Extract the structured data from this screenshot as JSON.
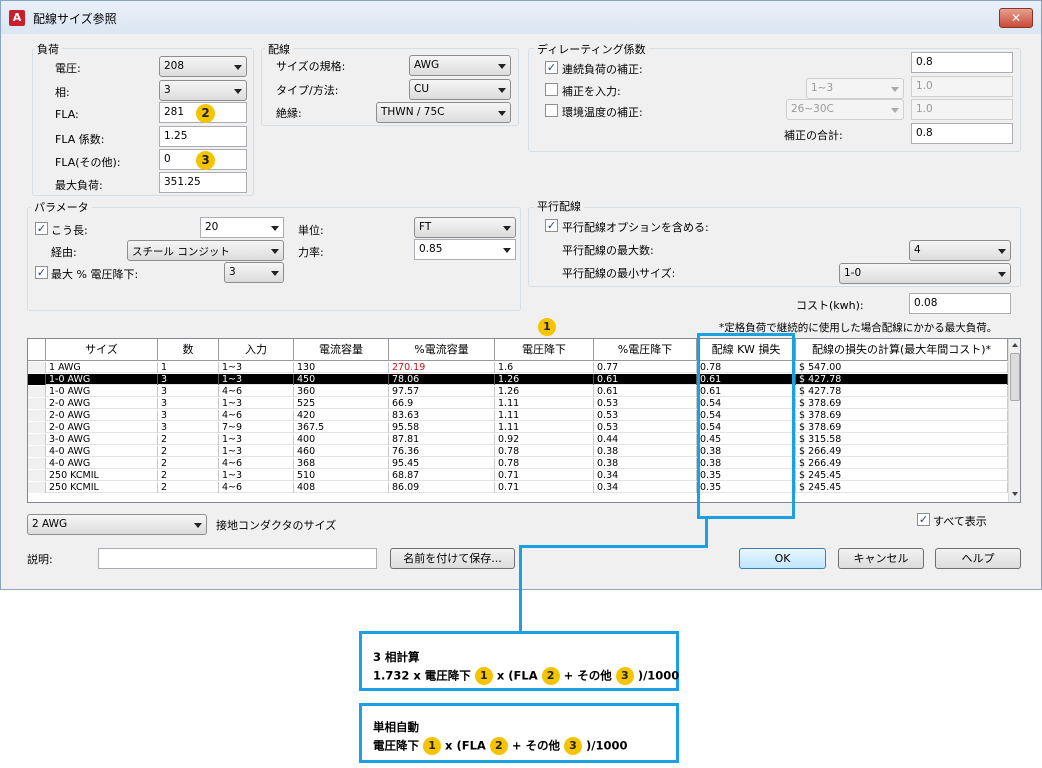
{
  "window": {
    "title": "配線サイズ参照",
    "app_icon": "A",
    "close_glyph": "✕"
  },
  "load": {
    "title": "負荷",
    "voltage_label": "電圧:",
    "voltage": "208",
    "phase_label": "相:",
    "phase": "3",
    "fla_label": "FLA:",
    "fla": "281",
    "fla_factor_label": "FLA 係数:",
    "fla_factor": "1.25",
    "fla_other_label": "FLA(その他):",
    "fla_other": "0",
    "max_load_label": "最大負荷:",
    "max_load": "351.25"
  },
  "wiring": {
    "title": "配線",
    "size_standard_label": "サイズの規格:",
    "size_standard": "AWG",
    "type_label": "タイプ/方法:",
    "type": "CU",
    "insulation_label": "絶縁:",
    "insulation": "THWN / 75C"
  },
  "derating": {
    "title": "ディレーティング係数",
    "continuous_label": "連続負荷の補正:",
    "continuous_checked": true,
    "continuous_value": "0.8",
    "adjust_label": "補正を入力:",
    "adjust_checked": false,
    "adjust_select": "1~3",
    "adjust_value": "1.0",
    "ambient_label": "環境温度の補正:",
    "ambient_checked": false,
    "ambient_select": "26~30C",
    "ambient_value": "1.0",
    "total_label": "補正の合計:",
    "total_value": "0.8"
  },
  "params": {
    "title": "パラメータ",
    "length_label": "こう長:",
    "length_checked": true,
    "length": "20",
    "unit_label": "単位:",
    "unit": "FT",
    "route_label": "経由:",
    "route": "スチール コンジット",
    "power_factor_label": "力率:",
    "power_factor": "0.85",
    "max_vdrop_label": "最大 % 電圧降下:",
    "max_vdrop_checked": true,
    "max_vdrop": "3"
  },
  "parallel": {
    "title": "平行配線",
    "include_label": "平行配線オプションを含める:",
    "include_checked": true,
    "max_count_label": "平行配線の最大数:",
    "max_count": "4",
    "min_size_label": "平行配線の最小サイズ:",
    "min_size": "1-0"
  },
  "cost": {
    "label": "コスト(kwh):",
    "value": "0.08"
  },
  "note": "*定格負荷で継続的に使用した場合配線にかかる最大負荷。",
  "table": {
    "headers": [
      "サイズ",
      "数",
      "入力",
      "電流容量",
      "%電流容量",
      "電圧降下",
      "%電圧降下",
      "配線 KW 損失",
      "配線の損失の計算(最大年間コスト)*"
    ],
    "rows": [
      [
        "1 AWG",
        "1",
        "1~3",
        "130",
        "270.19",
        "1.6",
        "0.77",
        "0.78",
        "$ 547.00"
      ],
      [
        "1-0 AWG",
        "3",
        "1~3",
        "450",
        "78.06",
        "1.26",
        "0.61",
        "0.61",
        "$ 427.78"
      ],
      [
        "1-0 AWG",
        "3",
        "4~6",
        "360",
        "97.57",
        "1.26",
        "0.61",
        "0.61",
        "$ 427.78"
      ],
      [
        "2-0 AWG",
        "3",
        "1~3",
        "525",
        "66.9",
        "1.11",
        "0.53",
        "0.54",
        "$ 378.69"
      ],
      [
        "2-0 AWG",
        "3",
        "4~6",
        "420",
        "83.63",
        "1.11",
        "0.53",
        "0.54",
        "$ 378.69"
      ],
      [
        "2-0 AWG",
        "3",
        "7~9",
        "367.5",
        "95.58",
        "1.11",
        "0.53",
        "0.54",
        "$ 378.69"
      ],
      [
        "3-0 AWG",
        "2",
        "1~3",
        "400",
        "87.81",
        "0.92",
        "0.44",
        "0.45",
        "$ 315.58"
      ],
      [
        "4-0 AWG",
        "2",
        "1~3",
        "460",
        "76.36",
        "0.78",
        "0.38",
        "0.38",
        "$ 266.49"
      ],
      [
        "4-0 AWG",
        "2",
        "4~6",
        "368",
        "95.45",
        "0.78",
        "0.38",
        "0.38",
        "$ 266.49"
      ],
      [
        "250 KCMIL",
        "2",
        "1~3",
        "510",
        "68.87",
        "0.71",
        "0.34",
        "0.35",
        "$ 245.45"
      ],
      [
        "250 KCMIL",
        "2",
        "4~6",
        "408",
        "86.09",
        "0.71",
        "0.34",
        "0.35",
        "$ 245.45"
      ]
    ],
    "selected_row": 1,
    "red_cell": {
      "row": 0,
      "col": 4
    }
  },
  "ground": {
    "value": "2 AWG",
    "label": "接地コンダクタのサイズ"
  },
  "show_all": {
    "label": "すべて表示",
    "checked": true
  },
  "description": {
    "label": "説明:",
    "value": ""
  },
  "buttons": {
    "save_as": "名前を付けて保存...",
    "ok": "OK",
    "cancel": "キャンセル",
    "help": "ヘルプ"
  },
  "badges": {
    "one": "1",
    "two": "2",
    "three": "3"
  },
  "formula_three_phase": {
    "title": "3 相計算",
    "prefix": "1.732 x 電圧降下",
    "mid1": "x (FLA",
    "mid2": "+ その他",
    "suffix": ")/1000"
  },
  "formula_single_phase": {
    "title": "単相自動",
    "prefix": "電圧降下",
    "mid1": "x (FLA",
    "mid2": "+ その他",
    "suffix": ")/1000"
  },
  "colors": {
    "badge": "#f5c400",
    "highlight": "#1ba1e2",
    "warning_text": "#d01010"
  }
}
